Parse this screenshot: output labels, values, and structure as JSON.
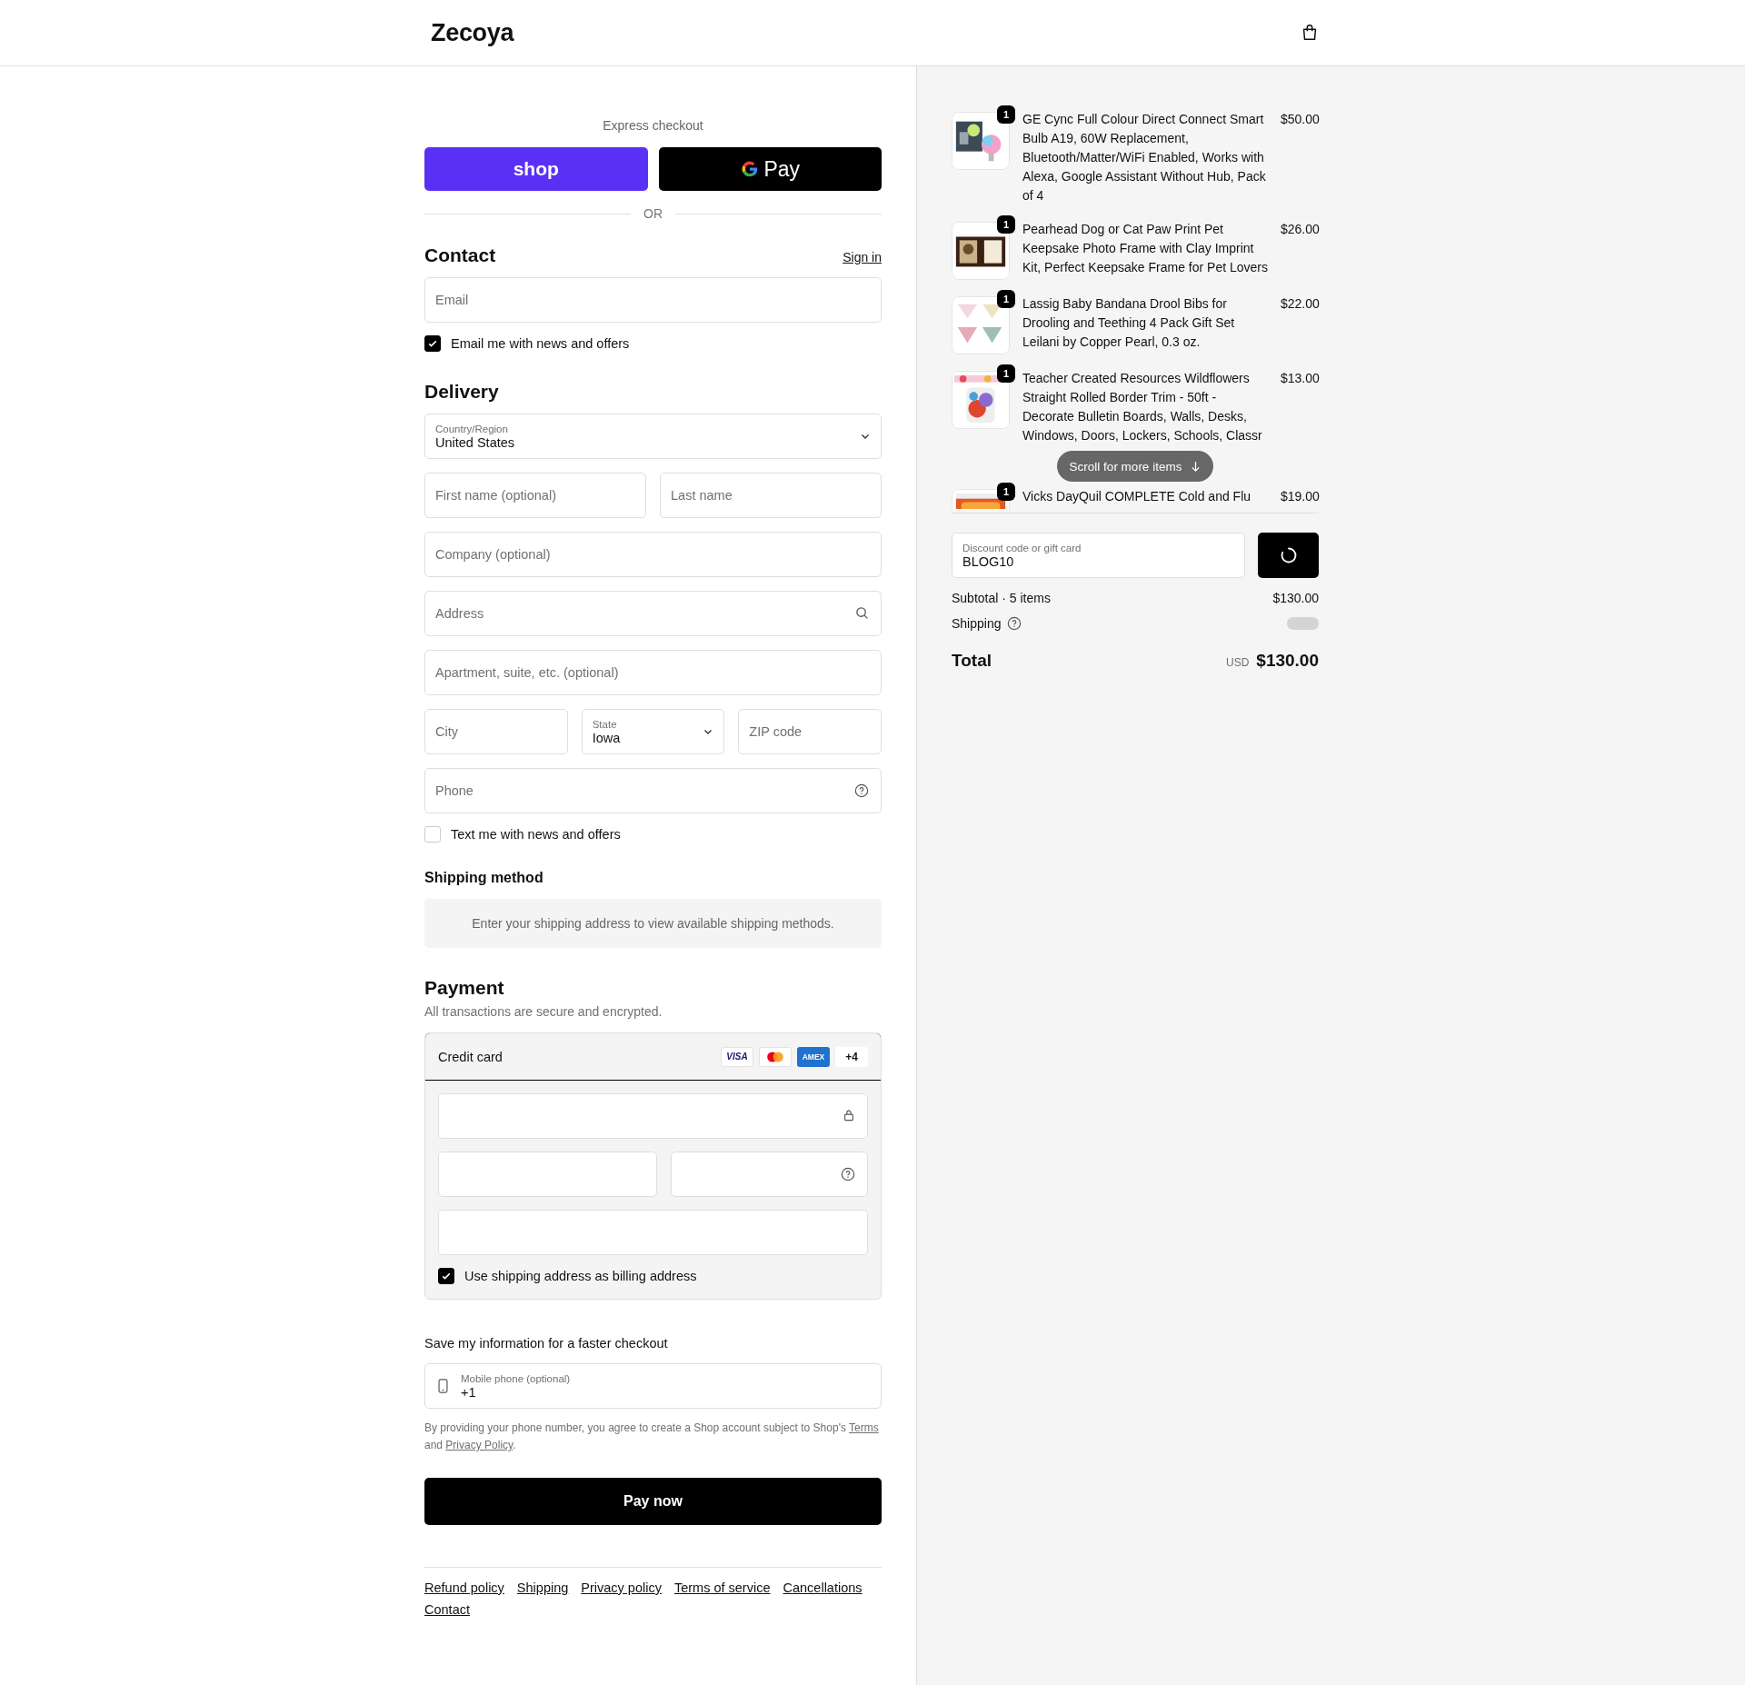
{
  "header": {
    "logo": "Zecoya"
  },
  "express": {
    "title": "Express checkout",
    "buttons": [
      {
        "kind": "shop",
        "label": "shop"
      },
      {
        "kind": "gpay",
        "label": "Pay"
      }
    ],
    "divider": "OR"
  },
  "contact": {
    "heading": "Contact",
    "sign_in": "Sign in",
    "email": {
      "placeholder": "Email"
    },
    "newsletter": {
      "label": "Email me with news and offers",
      "checked": true
    }
  },
  "delivery": {
    "heading": "Delivery",
    "rows": [
      [
        {
          "kind": "select",
          "label": "Country/Region",
          "value": "United States"
        }
      ],
      [
        {
          "kind": "text",
          "placeholder": "First name (optional)"
        },
        {
          "kind": "text",
          "placeholder": "Last name"
        }
      ],
      [
        {
          "kind": "text",
          "placeholder": "Company (optional)"
        }
      ],
      [
        {
          "kind": "address",
          "placeholder": "Address"
        }
      ],
      [
        {
          "kind": "text",
          "placeholder": "Apartment, suite, etc. (optional)"
        }
      ],
      [
        {
          "kind": "text",
          "placeholder": "City"
        },
        {
          "kind": "select",
          "label": "State",
          "value": "Iowa"
        },
        {
          "kind": "text",
          "placeholder": "ZIP code"
        }
      ],
      [
        {
          "kind": "phone",
          "placeholder": "Phone"
        }
      ]
    ],
    "sms": {
      "label": "Text me with news and offers",
      "checked": false
    }
  },
  "shipping_method": {
    "heading": "Shipping method",
    "notice": "Enter your shipping address to view available shipping methods."
  },
  "payment": {
    "heading": "Payment",
    "subtitle": "All transactions are secure and encrypted.",
    "method": "Credit card",
    "brands": [
      {
        "kind": "visa",
        "text": "VISA"
      },
      {
        "kind": "mastercard"
      },
      {
        "kind": "amex",
        "text": "AMEX"
      },
      {
        "kind": "more",
        "text": "+4"
      }
    ],
    "billing": {
      "label": "Use shipping address as billing address",
      "checked": true
    }
  },
  "save_info": {
    "heading": "Save my information for a faster checkout",
    "mobile": {
      "label": "Mobile phone (optional)",
      "value": "+1"
    },
    "legal": {
      "before": "By providing your phone number, you agree to create a Shop account subject to Shop's ",
      "link_1": "Terms",
      "middle": " and ",
      "link_2": "Privacy Policy",
      "after": "."
    }
  },
  "pay_button": "Pay now",
  "footer_links": [
    "Refund policy",
    "Shipping",
    "Privacy policy",
    "Terms of service",
    "Cancellations",
    "Contact"
  ],
  "order": {
    "items": [
      {
        "title": "GE Cync Full Colour Direct Connect Smart Bulb A19, 60W Replacement, Bluetooth/Matter/WiFi Enabled, Works with Alexa, Google Assistant Without Hub, Pack of 4",
        "price": "$50.00",
        "quantity": "1"
      },
      {
        "title": "Pearhead Dog or Cat Paw Print Pet Keepsake Photo Frame with Clay Imprint Kit, Perfect Keepsake Frame for Pet Lovers",
        "price": "$26.00",
        "quantity": "1"
      },
      {
        "title": "Lassig Baby Bandana Drool Bibs for Drooling and Teething 4 Pack Gift Set Leilani by Copper Pearl, 0.3 oz.",
        "price": "$22.00",
        "quantity": "1"
      },
      {
        "title": "Teacher Created Resources Wildflowers Straight Rolled Border Trim - 50ft - Decorate Bulletin Boards, Walls, Desks, Windows, Doors, Lockers, Schools, Classr",
        "price": "$13.00",
        "quantity": "1"
      },
      {
        "title": "Vicks DayQuil COMPLETE Cold and Flu",
        "price": "$19.00",
        "quantity": "1"
      }
    ],
    "scroll_hint": "Scroll for more items",
    "discount": {
      "label": "Discount code or gift card",
      "value": "BLOG10"
    },
    "subtotal": {
      "label": "Subtotal · 5 items",
      "value": "$130.00"
    },
    "shipping_label": "Shipping",
    "total": {
      "label": "Total",
      "currency": "USD",
      "value": "$130.00"
    }
  }
}
